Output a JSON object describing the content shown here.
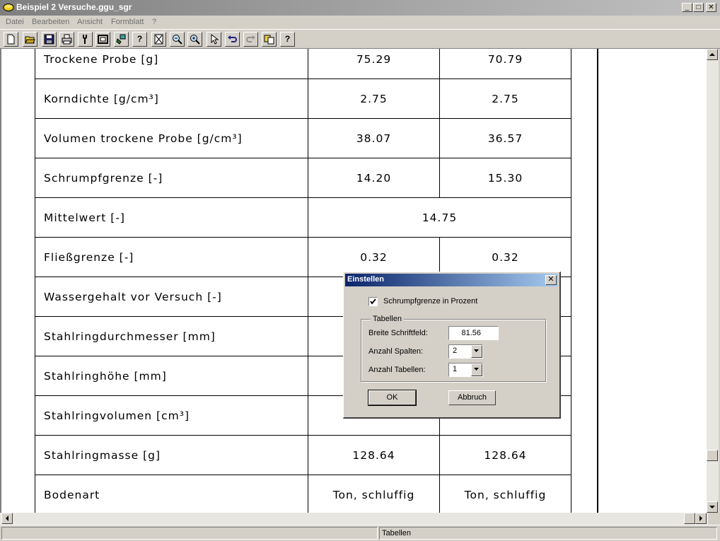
{
  "window": {
    "title": "Beispiel 2 Versuche.ggu_sgr",
    "min_glyph": "_",
    "max_glyph": "□",
    "close_glyph": "✕"
  },
  "menu": [
    "Datei",
    "Bearbeiten",
    "Ansicht",
    "Formblatt",
    "?"
  ],
  "toolbar": {
    "icons": [
      "new-file-icon",
      "open-folder-icon",
      "save-disk-icon",
      "print-icon",
      "tool-icon",
      "frame-icon",
      "paint-icon",
      "help-icon",
      "eraser-icon",
      "zoom-out-icon",
      "zoom-in-icon",
      "pointer-icon",
      "undo-icon",
      "redo-icon",
      "copy-icon",
      "help-icon"
    ],
    "help_glyph": "?"
  },
  "table": {
    "rows": [
      {
        "label": "Trockene Probe [g]",
        "values": [
          "75.29",
          "70.79"
        ]
      },
      {
        "label": "Korndichte [g/cm³]",
        "values": [
          "2.75",
          "2.75"
        ]
      },
      {
        "label": "Volumen trockene Probe [g/cm³]",
        "values": [
          "38.07",
          "36.57"
        ]
      },
      {
        "label": "Schrumpfgrenze [-]",
        "values": [
          "14.20",
          "15.30"
        ]
      },
      {
        "label": "Mittelwert [-]",
        "merged": "14.75"
      },
      {
        "label": "Fließgrenze [-]",
        "values": [
          "0.32",
          "0.32"
        ]
      },
      {
        "label": "Wassergehalt vor Versuch [-]",
        "values": [
          "",
          ""
        ]
      },
      {
        "label": "Stahlringdurchmesser [mm]",
        "values": [
          "",
          ""
        ]
      },
      {
        "label": "Stahlringhöhe [mm]",
        "values": [
          "",
          ""
        ]
      },
      {
        "label": "Stahlringvolumen [cm³]",
        "values": [
          "",
          ""
        ]
      },
      {
        "label": "Stahlringmasse [g]",
        "values": [
          "128.64",
          "128.64"
        ]
      },
      {
        "label": "Bodenart",
        "values": [
          "Ton, schluffig",
          "Ton, schluffig"
        ]
      }
    ]
  },
  "dialog": {
    "title": "Einstellen",
    "close_glyph": "✕",
    "checkbox_label": "Schrumpfgrenze in Prozent",
    "checkbox_checked": true,
    "check_glyph": "✓",
    "group_label": "Tabellen",
    "breite_label": "Breite Schriftfeld:",
    "breite_value": "81.56",
    "spalten_label": "Anzahl Spalten:",
    "spalten_value": "2",
    "tabellen_label": "Anzahl Tabellen:",
    "tabellen_value": "1",
    "ok_label": "OK",
    "cancel_label": "Abbruch"
  },
  "status": {
    "pane_text": "Tabellen"
  }
}
